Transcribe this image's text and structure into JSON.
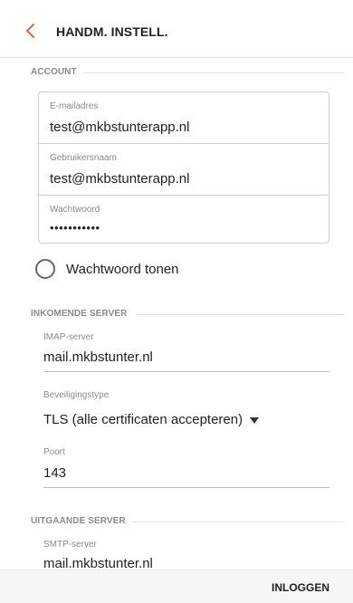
{
  "header": {
    "title": "HANDM. INSTELL."
  },
  "account": {
    "section_title": "ACCOUNT",
    "email": {
      "label": "E-mailadres",
      "value": "test@mkbstunterapp.nl"
    },
    "username": {
      "label": "Gebruikersnaam",
      "value": "test@mkbstunterapp.nl"
    },
    "password": {
      "label": "Wachtwoord",
      "value": "•••••••••••"
    },
    "show_password_label": "Wachtwoord tonen"
  },
  "incoming": {
    "section_title": "INKOMENDE SERVER",
    "imap": {
      "label": "IMAP-server",
      "value": "mail.mkbstunter.nl"
    },
    "security": {
      "label": "Beveiligingstype",
      "value": "TLS (alle certificaten accepteren)"
    },
    "port": {
      "label": "Poort",
      "value": "143"
    }
  },
  "outgoing": {
    "section_title": "UITGAANDE SERVER",
    "smtp": {
      "label": "SMTP-server",
      "value": "mail.mkbstunter.nl"
    }
  },
  "footer": {
    "login_label": "INLOGGEN"
  },
  "colors": {
    "accent": "#e4604b"
  }
}
